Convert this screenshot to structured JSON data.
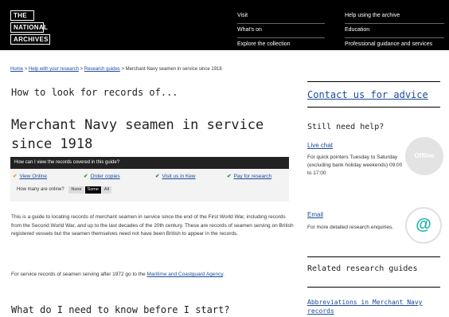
{
  "logo": {
    "line1": "THE",
    "line2": "NATIONAL",
    "line3": "ARCHIVES"
  },
  "nav": {
    "col1": [
      "Visit",
      "What's on",
      "Explore the collection"
    ],
    "col2": [
      "Help using the archive",
      "Education",
      "Professional guidance and services"
    ]
  },
  "breadcrumb": {
    "home": "Home",
    "sep": ">",
    "help": "Help with your research",
    "guides": "Research guides",
    "current": "Merchant Navy seamen in service since 1918"
  },
  "page": {
    "howto": "How to look for records of...",
    "title": "Merchant Navy seamen in service since 1918"
  },
  "viewbox": {
    "heading": "How can I view the records covered in this guide?",
    "options": [
      "View Online",
      "Order copies",
      "Visit us in Kew",
      "Pay for research"
    ],
    "online_label": "How many are online?",
    "online_choices": [
      "None",
      "Some",
      "All"
    ],
    "online_selected": "Some"
  },
  "content": {
    "intro": "This is a guide to locating records of merchant seamen in service since the end of the First World War, including records from the Second World War, and up to the last decades of the 20th century. These are records of seamen serving on British registered vessels but the seamen themselves need not have been British to appear in the records.",
    "service_prefix": "For service records of seamen serving after 1972 go to the ",
    "service_link": "Maritime and Coastguard Agency",
    "service_suffix": ".",
    "h2": "What do I need to know before I start?"
  },
  "sidebar": {
    "contact": "Contact us for advice",
    "still_help": "Still need help?",
    "live_chat": "Live chat",
    "chat_text": "For quick pointers Tuesday to Saturday (excluding bank holiday weekends) 09:00 to 17:00",
    "offline": "Offline",
    "email": "Email",
    "email_text": "For more detailed research enquiries.",
    "at_icon": "@",
    "related": "Related research guides",
    "related_links": [
      "Abbreviations in Merchant Navy records"
    ]
  },
  "colors": {
    "link": "#1a4a9a",
    "tick": "#2e8b2e",
    "topbar": "#000000",
    "at": "#1ab3a7"
  }
}
